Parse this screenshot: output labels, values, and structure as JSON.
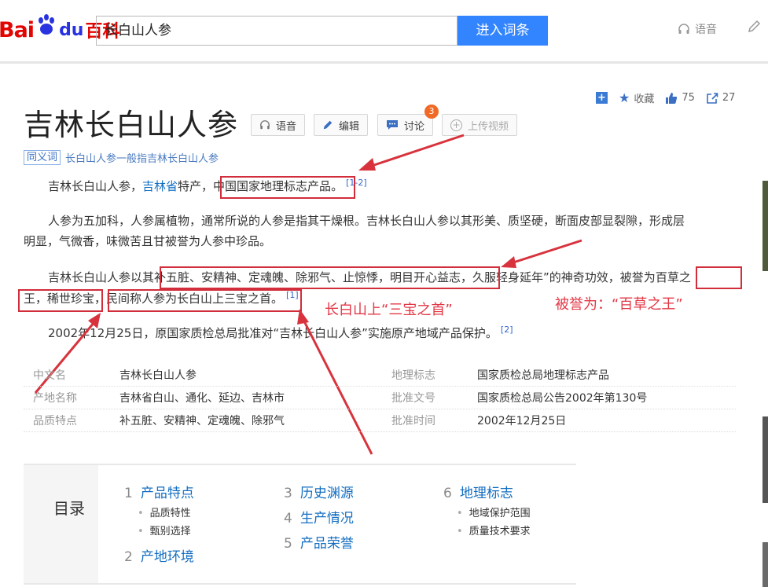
{
  "header": {
    "logo_bai": "Bai",
    "logo_du": "du",
    "logo_baike": "百科",
    "search_value": "长白山人参",
    "enter_button": "进入词条",
    "voice_label": "语音"
  },
  "tools": {
    "collect_label": "收藏",
    "like_count": "75",
    "share_count": "27"
  },
  "article": {
    "title": "吉林长白山人参",
    "buttons": {
      "voice": "语音",
      "edit": "编辑",
      "discuss": "讨论",
      "upload_video": "上传视频"
    },
    "discuss_badge": "3",
    "synonym_tag": "同义词",
    "synonym_text": "长白山人参一般指吉林长白山人参",
    "p1": {
      "a": "吉林长白山人参，",
      "link": "吉林省",
      "b": "特产，",
      "c": "中国国家地理标志产品",
      "d": "。",
      "ref": "[1-2]"
    },
    "p2_line1": "人参为五加科，人参属植物，通常所说的人参是指其干燥根。吉林长白山人参以其形美、质坚硬，断面皮部显裂隙，形成层",
    "p2_line2": "明显，气微香，味微苦且甘被誉为人参中珍品。",
    "p3_line1": {
      "a": "吉林长白山人参以其",
      "b": "补五脏、安精神、定魂魄、除邪气、止惊悸，明目开心益志，",
      "c": "久服轻身延年”的神奇功效，被誉为",
      "d": "百草之"
    },
    "p3_line2": {
      "a": "王，稀世珍宝，",
      "b": "民间称人参为长白山上三宝之首。",
      "ref": "[1]"
    },
    "p4": {
      "text": "2002年12月25日，原国家质检总局批准对“吉林长白山人参”实施原产地域产品保护。",
      "ref": "[2]"
    }
  },
  "annotations": {
    "three_treasures": "长白山上“三宝之首”",
    "king_of_herbs": "被誉为：“百草之王”"
  },
  "info": [
    {
      "label": "中文名",
      "value": "吉林长白山人参",
      "label2": "地理标志",
      "value2": "国家质检总局地理标志产品"
    },
    {
      "label": "产地名称",
      "value": "吉林省白山、通化、延边、吉林市",
      "label2": "批准文号",
      "value2": "国家质检总局公告2002年第130号"
    },
    {
      "label": "品质特点",
      "value": "补五脏、安精神、定魂魄、除邪气",
      "label2": "批准时间",
      "value2": "2002年12月25日"
    }
  ],
  "toc": {
    "title": "目录",
    "items": [
      {
        "num": "1",
        "label": "产品特点",
        "subs": [
          "品质特性",
          "甄别选择"
        ]
      },
      {
        "num": "2",
        "label": "产地环境"
      },
      {
        "num": "3",
        "label": "历史渊源"
      },
      {
        "num": "4",
        "label": "生产情况"
      },
      {
        "num": "5",
        "label": "产品荣誉"
      },
      {
        "num": "6",
        "label": "地理标志",
        "subs": [
          "地域保护范围",
          "质量技术要求"
        ]
      }
    ]
  },
  "colors": {
    "accent": "#3385ff",
    "brand_red": "#e10602",
    "annotation_red": "#d12d3a"
  }
}
